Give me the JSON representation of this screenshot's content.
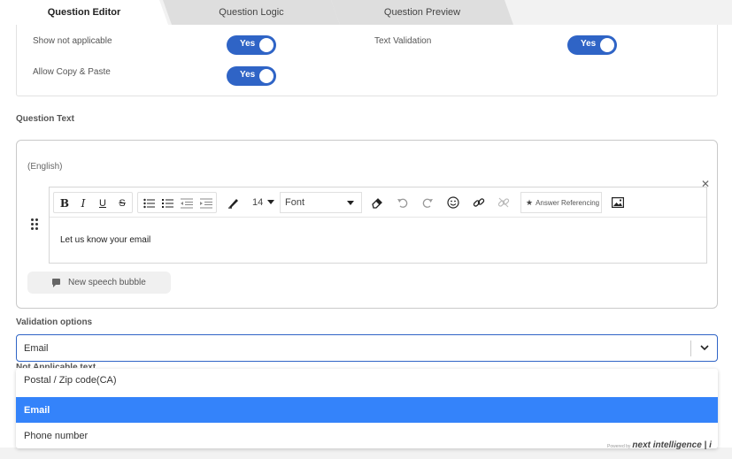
{
  "tabs": [
    {
      "label": "Question Editor",
      "active": true
    },
    {
      "label": "Question Logic",
      "active": false
    },
    {
      "label": "Question Preview",
      "active": false
    }
  ],
  "settings": {
    "show_not_applicable": {
      "label": "Show not applicable",
      "value": "Yes"
    },
    "text_validation": {
      "label": "Text Validation",
      "value": "Yes"
    },
    "allow_copy_paste": {
      "label": "Allow Copy & Paste",
      "value": "Yes"
    }
  },
  "question_text": {
    "section_label": "Question Text",
    "language": "(English)",
    "toolbar": {
      "font_size": "14",
      "font_family": "Font",
      "answer_referencing": "Answer Referencing"
    },
    "content": "Let us know your email",
    "speech_bubble_label": "New speech bubble"
  },
  "validation": {
    "section_label": "Validation options",
    "selected": "Email",
    "options": [
      "Postal / Zip code(CA)",
      "Email",
      "Phone number"
    ],
    "selected_index": 1
  },
  "hidden_label": "Not Applicable text",
  "footer": {
    "powered_by": "Powered by",
    "brand": "next intelligence | i"
  },
  "colors": {
    "accent": "#2f64c6",
    "option_selected": "#3483fa"
  }
}
